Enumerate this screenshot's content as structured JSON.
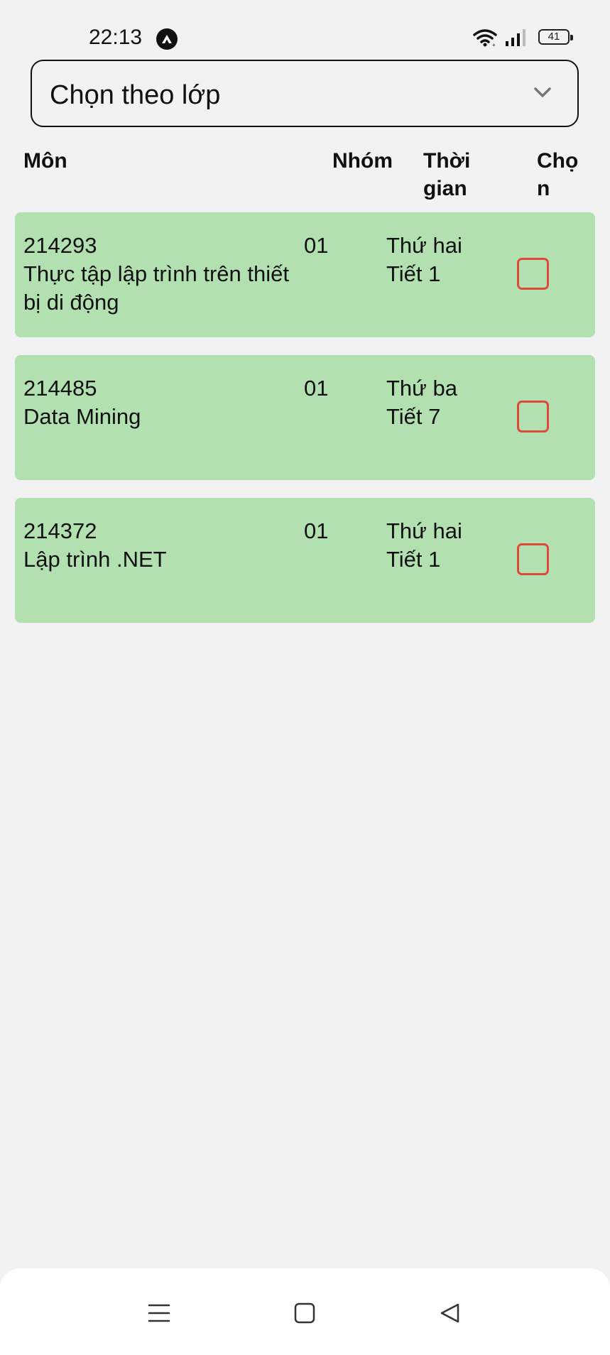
{
  "status_bar": {
    "time": "22:13",
    "battery": "41",
    "icons": [
      "app-notification-icon",
      "wifi-icon",
      "signal-icon",
      "battery-icon"
    ]
  },
  "filter": {
    "label": "Chọn theo lớp",
    "icon": "chevron-down-icon"
  },
  "table": {
    "headers": {
      "subject": "Môn",
      "group": "Nhóm",
      "time": "Thời gian",
      "select": "Chọn"
    },
    "rows": [
      {
        "code": "214293",
        "name": "Thực tập lập trình trên thiết bị di động",
        "group": "01",
        "day": "Thứ hai",
        "period": "Tiết 1",
        "checked": false
      },
      {
        "code": "214485",
        "name": "Data Mining",
        "group": "01",
        "day": "Thứ ba",
        "period": "Tiết 7",
        "checked": false
      },
      {
        "code": "214372",
        "name": "Lập trình .NET",
        "group": "01",
        "day": "Thứ hai",
        "period": "Tiết 1",
        "checked": false
      }
    ]
  },
  "nav_bar": {
    "icons": [
      "menu-icon",
      "home-square-icon",
      "back-triangle-icon"
    ]
  },
  "colors": {
    "background": "#f2f2f2",
    "row_background": "#b3e0b1",
    "checkbox_border": "#e0483a"
  }
}
